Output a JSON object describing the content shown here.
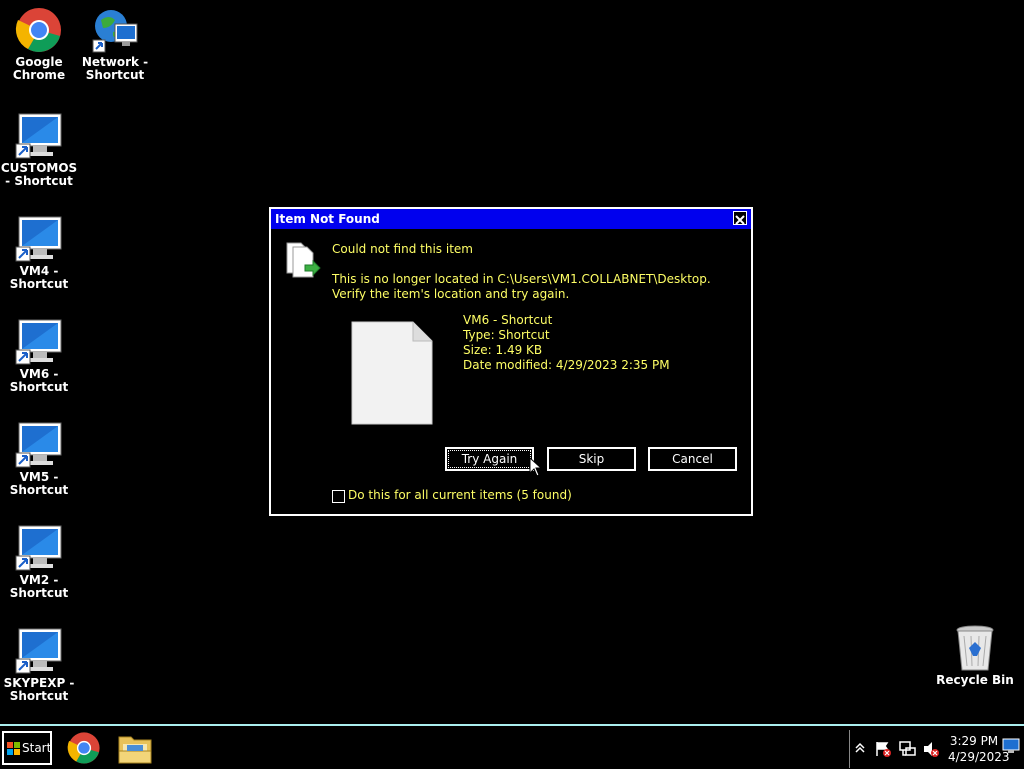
{
  "desktop": {
    "icons": [
      {
        "label": "Google\nChrome",
        "icon": "chrome-icon"
      },
      {
        "label": "Network -\nShortcut",
        "icon": "network-globe-icon"
      },
      {
        "label": "CUSTOMOS\n- Shortcut",
        "icon": "monitor-icon"
      },
      {
        "label": "VM4 -\nShortcut",
        "icon": "monitor-icon"
      },
      {
        "label": "VM6 -\nShortcut",
        "icon": "monitor-icon"
      },
      {
        "label": "VM5 -\nShortcut",
        "icon": "monitor-icon"
      },
      {
        "label": "VM2 -\nShortcut",
        "icon": "monitor-icon"
      },
      {
        "label": "SKYPEXP -\nShortcut",
        "icon": "monitor-icon"
      },
      {
        "label": "Recycle Bin",
        "icon": "recycle-bin-icon"
      }
    ]
  },
  "dialog": {
    "title": "Item Not Found",
    "heading": "Could not find this item",
    "message": "This is no longer located in C:\\Users\\VM1.COLLABNET\\Desktop. Verify the item's location and try again.",
    "item": {
      "name": "VM6 - Shortcut",
      "type": "Type: Shortcut",
      "size": "Size: 1.49 KB",
      "modified": "Date modified: 4/29/2023 2:35 PM"
    },
    "buttons": {
      "try_again": "Try Again",
      "skip": "Skip",
      "cancel": "Cancel"
    },
    "checkbox_label": "Do this for all current items (5 found)"
  },
  "taskbar": {
    "start_label": "Start",
    "pinned": [
      "chrome-icon",
      "file-explorer-icon"
    ],
    "clock_time": "3:29 PM",
    "clock_date": "4/29/2023"
  },
  "colors": {
    "titlebar": "#0000ee",
    "dialog_text": "#ffff66",
    "taskbar_border": "#aaeeee"
  }
}
